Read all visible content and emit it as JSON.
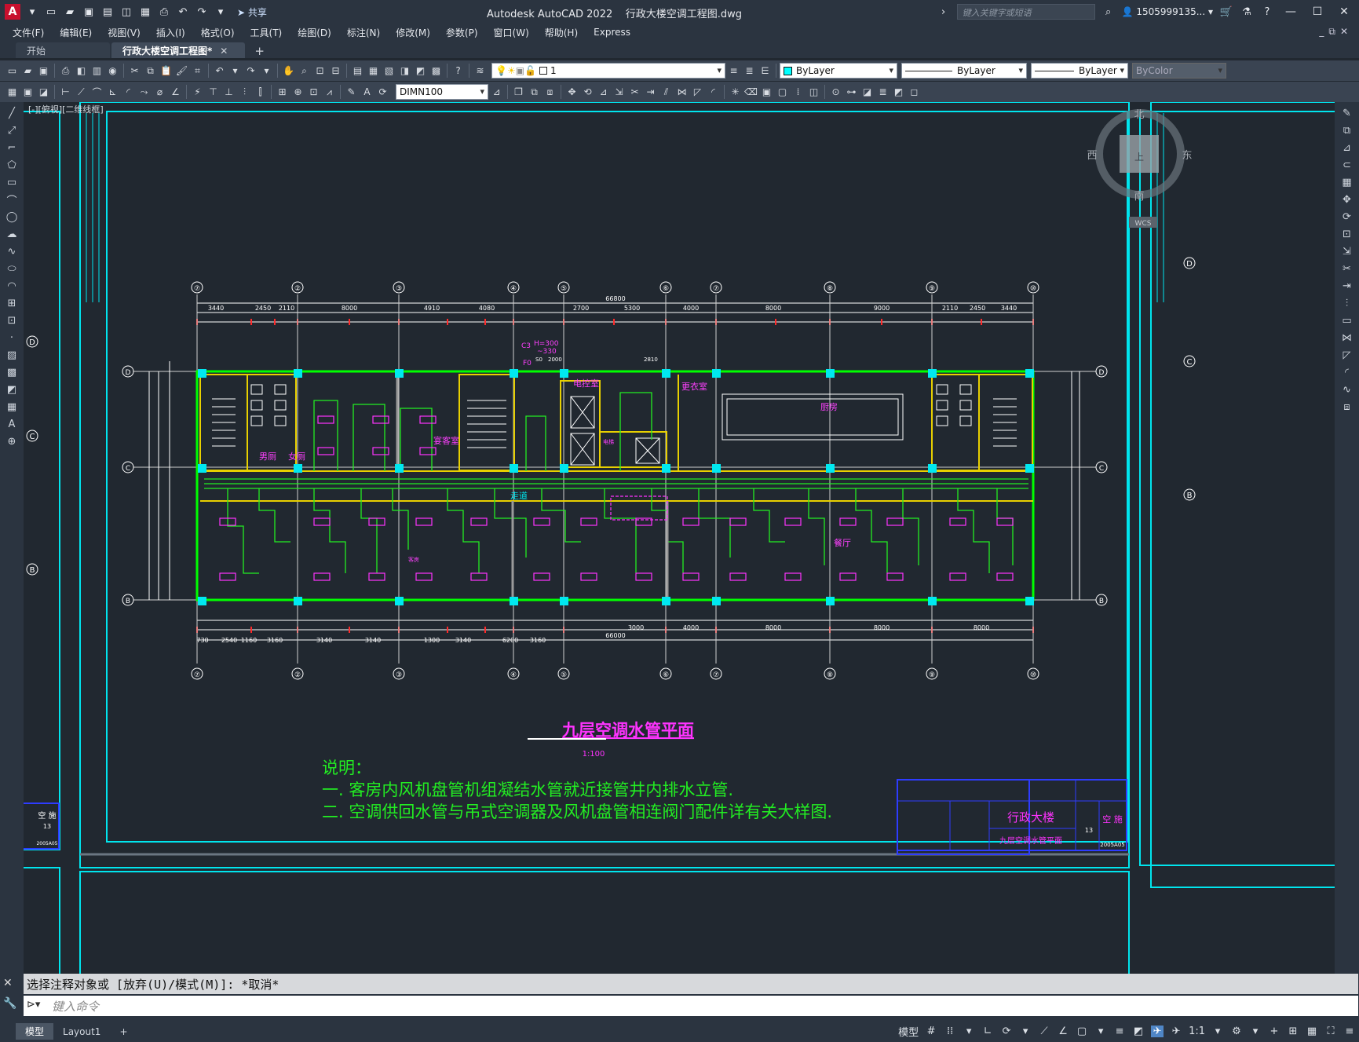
{
  "app": {
    "title": "Autodesk AutoCAD 2022",
    "filename": "行政大楼空调工程图.dwg",
    "share": "共享",
    "search_placeholder": "键入关键字或短语",
    "user": "1505999135...",
    "icons": [
      "autocad-logo",
      "new-icon",
      "open-icon",
      "save-icon",
      "saveas-icon",
      "web-icon",
      "print-icon",
      "undo-icon",
      "redo-icon",
      "share-icon",
      "search-icon",
      "user-icon",
      "cart-icon",
      "autodesk-app-icon",
      "help-icon",
      "minimize-icon",
      "maximize-icon",
      "close-icon"
    ]
  },
  "menu": [
    "文件(F)",
    "编辑(E)",
    "视图(V)",
    "插入(I)",
    "格式(O)",
    "工具(T)",
    "绘图(D)",
    "标注(N)",
    "修改(M)",
    "参数(P)",
    "窗口(W)",
    "帮助(H)",
    "Express"
  ],
  "tabs": {
    "start": "开始",
    "active": "行政大楼空调工程图*"
  },
  "toolbar": {
    "dimstyle": "DIMN100",
    "layer": "1",
    "color": "ByLayer",
    "linetype": "ByLayer",
    "lineweight": "ByLayer",
    "plotstyle": "ByColor",
    "colors": {
      "layer_swatch": "#00ffff"
    }
  },
  "viewport": {
    "label": "[-][俯视][二维线框]",
    "viewcube": {
      "north": "北",
      "south": "南",
      "east": "东",
      "west": "西",
      "top": "上",
      "wcs": "WCS"
    }
  },
  "drawing": {
    "top_axes": [
      "⑦",
      "②",
      "③",
      "④",
      "⑤",
      "⑥",
      "⑦",
      "⑧",
      "⑨",
      "⑩"
    ],
    "row_axes": [
      "D",
      "C",
      "B"
    ],
    "total_dim": "66800",
    "top_dims_row1": [
      "3440",
      "2450",
      "2110",
      "8000",
      "4080",
      "4910",
      "2700",
      "5300",
      "4000",
      "8000",
      "9000",
      "2110",
      "2450",
      "3440"
    ],
    "bottom_dims": [
      "730",
      "2540",
      "1160",
      "3160",
      "3140",
      "3140",
      "1300",
      "3140",
      "6200",
      "3160",
      "3000",
      "4000",
      "8000",
      "8000",
      "8000"
    ],
    "bottom_total": "66000",
    "rooms": {
      "male_toilet": "男厕",
      "female_toilet": "女厕",
      "guest": "宴客室",
      "elec": "电控室",
      "locker": "更衣室",
      "kitchen": "厨房",
      "corridor": "走道",
      "dining": "餐厅",
      "guestroom": "客房",
      "lift": "电梯"
    },
    "pipe_labels": [
      "C3",
      "H=300",
      "~330",
      "F0",
      "S0",
      "2000",
      "2810"
    ],
    "title": "九层空调水管平面",
    "scale": "1:100",
    "notes_title": "说明：",
    "note1": "一. 客房内风机盘管机组凝结水管就近接管井内排水立管.",
    "note2": "二. 空调供回水管与吊式空调器及风机盘管相连阀门配件详有关大样图.",
    "titleblock": {
      "project": "行政大楼",
      "drawing": "九层空调水管平面",
      "sheet": "13",
      "code": "2005A05",
      "type": "空 施"
    },
    "left_titleblock": {
      "type": "空 施",
      "sheet": "13",
      "code": "2005A05"
    }
  },
  "command": {
    "history": "选择注释对象或 [放弃(U)/模式(M)]: *取消*",
    "placeholder": "键入命令"
  },
  "status": {
    "model_tab": "模型",
    "layout_tab": "Layout1",
    "mode": "模型",
    "scale": "1:1"
  }
}
